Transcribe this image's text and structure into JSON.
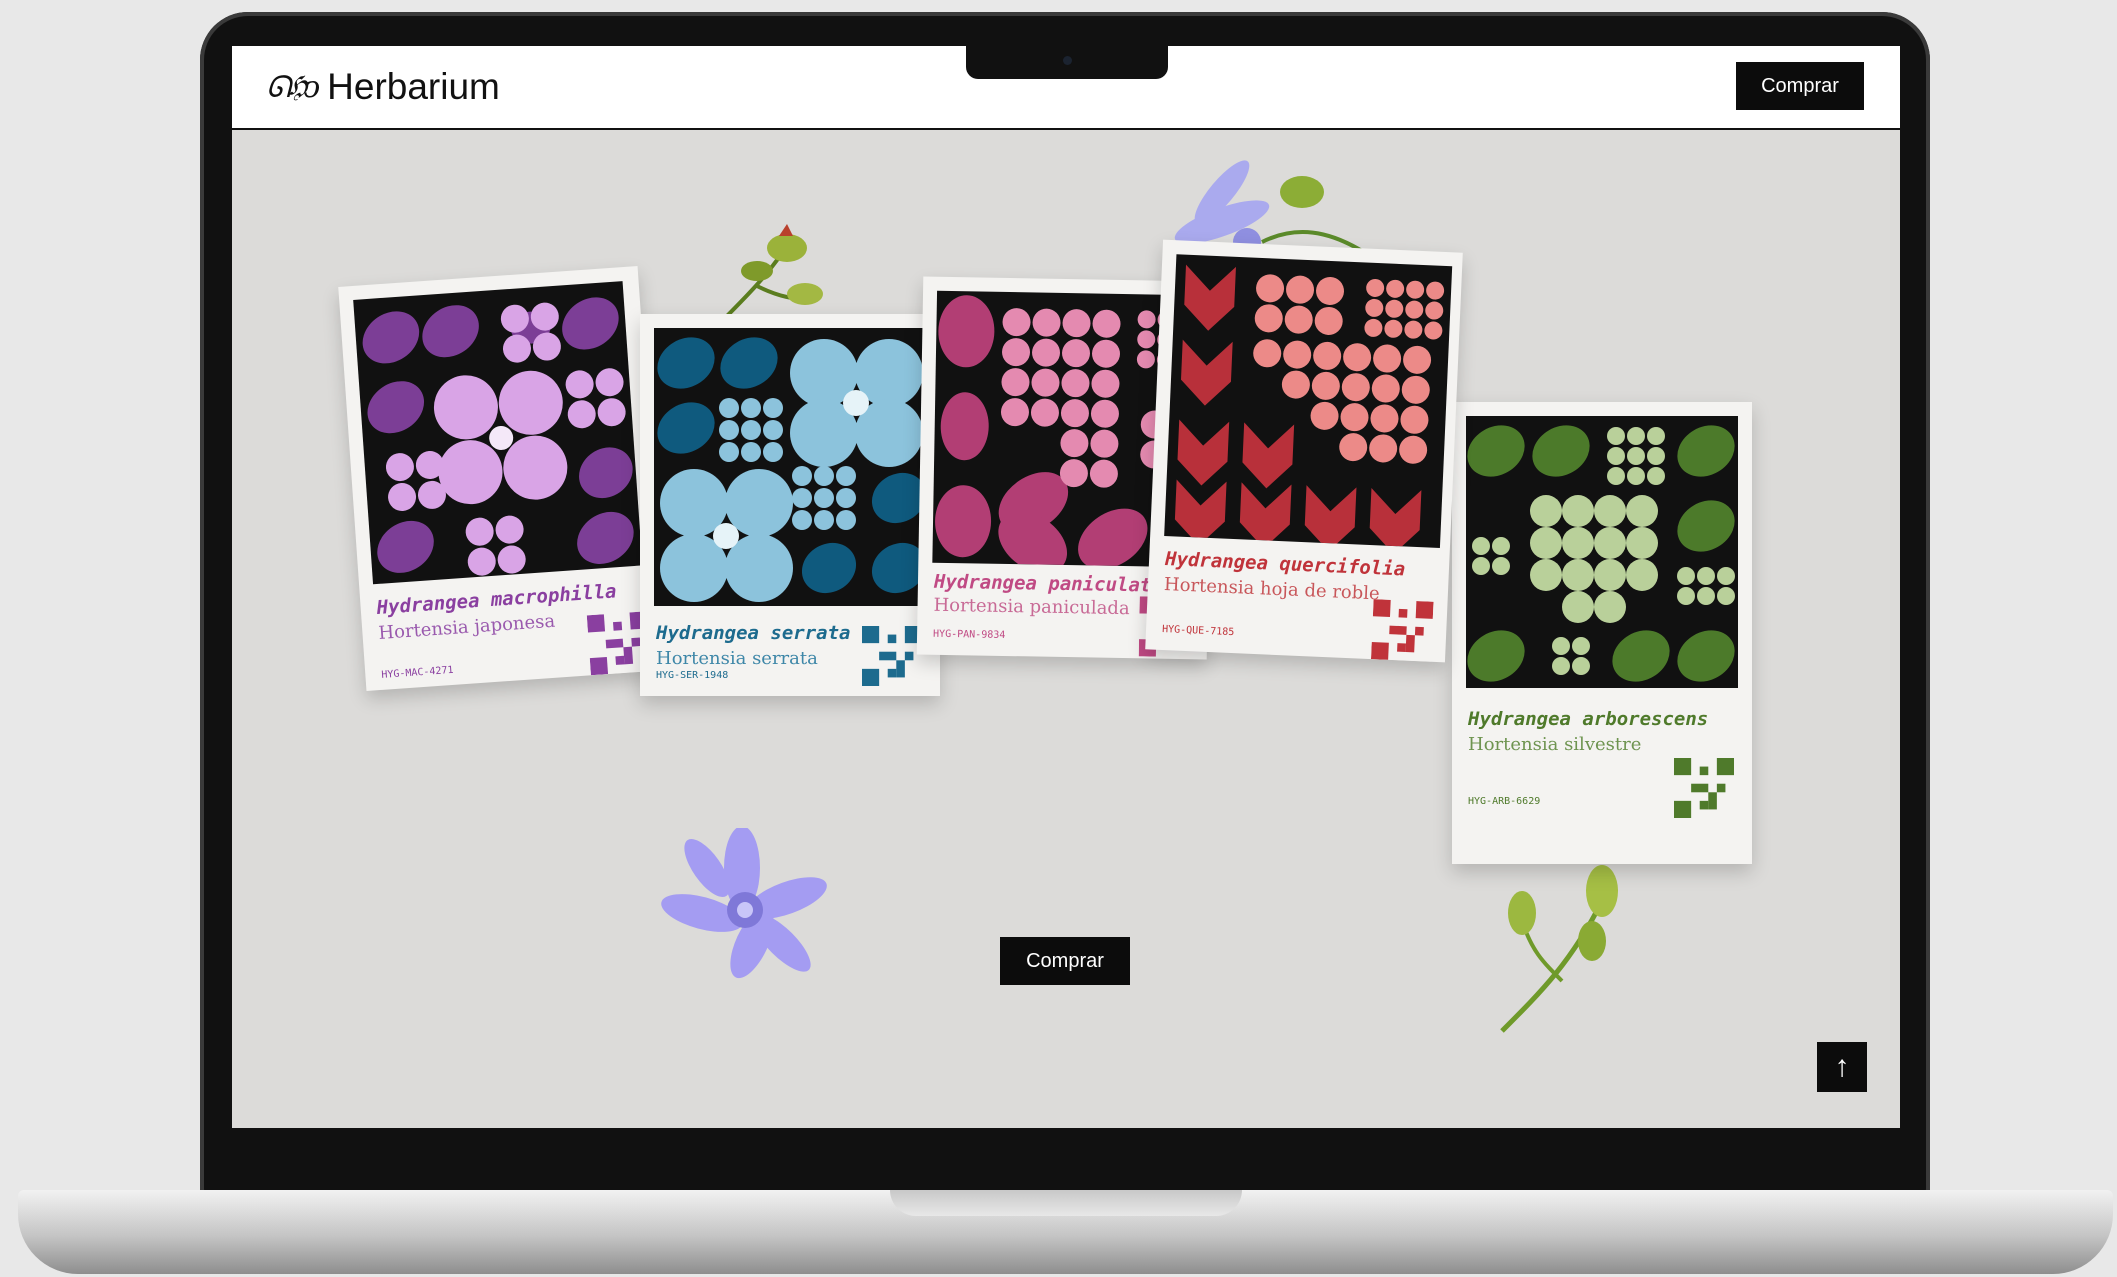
{
  "header": {
    "logo_mark": "ᘏℌↄ",
    "logo_text": "Herbarium",
    "buy_label": "Comprar"
  },
  "hero": {
    "buy_label": "Comprar",
    "scroll_top_label": "↑"
  },
  "cards": [
    {
      "title": "Hydrangea macrophilla",
      "subtitle": "Hortensia japonesa",
      "code": "HYG-MAC-4271",
      "color": "#8a3fa0"
    },
    {
      "title": "Hydrangea serrata",
      "subtitle": "Hortensia serrata",
      "code": "HYG-SER-1948",
      "color": "#1d6b8e"
    },
    {
      "title": "Hydrangea paniculata",
      "subtitle": "Hortensia paniculada",
      "code": "HYG-PAN-9834",
      "color": "#c04a84"
    },
    {
      "title": "Hydrangea quercifolia",
      "subtitle": "Hortensia hoja de roble",
      "code": "HYG-QUE-7185",
      "color": "#c0333a"
    },
    {
      "title": "Hydrangea arborescens",
      "subtitle": "Hortensia silvestre",
      "code": "HYG-ARB-6629",
      "color": "#4f7a2b"
    }
  ],
  "colors": {
    "screen_bg": "#dcdbd9",
    "header_bg": "#ffffff",
    "button_bg": "#0c0c0c"
  }
}
